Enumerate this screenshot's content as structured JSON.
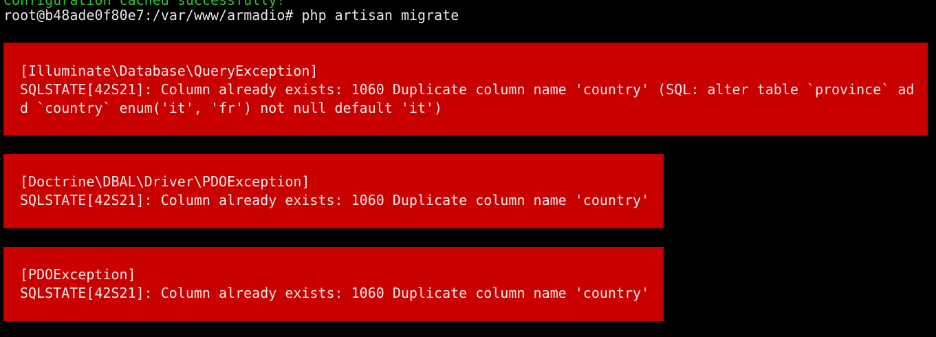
{
  "terminal": {
    "previous_output": "Configuration cached successfully!",
    "prompt": "root@b48ade0f80e7:/var/www/armadio#",
    "command": "php artisan migrate"
  },
  "errors": [
    {
      "exception": "[Illuminate\\Database\\QueryException]",
      "message_lines": [
        "SQLSTATE[42S21]: Column already exists: 1060 Duplicate column name 'country' (SQL: alter table `province` ad",
        "d `country` enum('it', 'fr') not null default 'it')"
      ]
    },
    {
      "exception": "[Doctrine\\DBAL\\Driver\\PDOException]",
      "message_lines": [
        "SQLSTATE[42S21]: Column already exists: 1060 Duplicate column name 'country'"
      ]
    },
    {
      "exception": "[PDOException]",
      "message_lines": [
        "SQLSTATE[42S21]: Column already exists: 1060 Duplicate column name 'country'"
      ]
    }
  ],
  "colors": {
    "background": "#000000",
    "text": "#e6e6e6",
    "success_text": "#2fc42f",
    "error_background": "#c80000"
  }
}
